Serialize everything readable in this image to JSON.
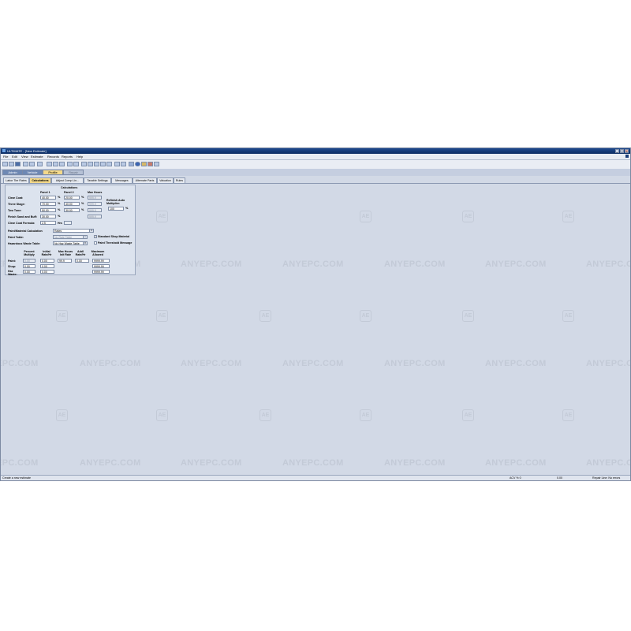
{
  "window": {
    "title": "ULTIMATE - [New Estimate]",
    "min": "_",
    "max": "□",
    "close": "×"
  },
  "menu": [
    "File",
    "Edit",
    "View",
    "Estimate",
    "Records",
    "Reports",
    "Help"
  ],
  "module_tabs": [
    "Admin",
    "Vehicle",
    "Profile",
    "Repair"
  ],
  "sub_tabs": [
    "Labor Tier Rates",
    "Calculations",
    "Adjust Comp Lin...",
    "Taxable Settings",
    "Messages",
    "Alternate Parts",
    "Valuation",
    "Rules"
  ],
  "calc": {
    "title": "Calculations",
    "col_paint1": "Panel 1",
    "col_paint2": "Panel 2",
    "col_max": "Max Hours",
    "rows": [
      {
        "label": "Clear Coat:",
        "p1": "40.00",
        "p2": "20.00",
        "max": "999.9"
      },
      {
        "label": "Three Stage:",
        "p1": "70.00",
        "p2": "40.00",
        "max": "999.9"
      },
      {
        "label": "Two Tone:",
        "p1": "50.00",
        "p2": "30.00",
        "max": "999.9"
      },
      {
        "label": "Finish Sand and Buff:",
        "p1": "30.00",
        "p2": "",
        "max": "999.9"
      }
    ],
    "pct": "%",
    "formula_label": "Clear Coat Formula:",
    "formula_value": "2.5",
    "formula_unit": "Hrs",
    "refinish_label": "Refinish Auto Multiplier:",
    "refinish_value": "100",
    "paint_material_label": "Paint/Material Calculation",
    "paint_material_value": "Rates",
    "paint_table_label": "Paint Table:",
    "paint_table_value": "No Rate Table",
    "hazwaste_label": "Hazardous Waste Table:",
    "hazwaste_value": "No Haz Waste Table",
    "std_shop_label": "Standard Shop Material",
    "paint_threshold_label": "Paint Threshold Message",
    "hdr_percent": "Percent Multiply",
    "hdr_initial": "Initial Rate/Hr",
    "hdr_maxhours": "Max Hours Init Rate",
    "hdr_addl": "Addl Rate/Hr",
    "hdr_maximum": "Maximum Allowed",
    "mat_rows": [
      {
        "label": "Paint:",
        "percent": "0.00",
        "initial": "0.00",
        "maxh": "99.9",
        "addl": "0.00",
        "maximum": "9999.99"
      },
      {
        "label": "Shop:",
        "percent": "0.00",
        "initial": "0.00",
        "maxh": "",
        "addl": "",
        "maximum": "9999.99"
      },
      {
        "label": "Haz Waste:",
        "percent": "0.00",
        "initial": "0.00",
        "maxh": "",
        "addl": "",
        "maximum": "9999.99"
      }
    ]
  },
  "watermark": {
    "text": "ANYEPC.COM",
    "logo": "AE"
  },
  "status": {
    "left": "Create a new estimate",
    "acv": "ACV % 0",
    "value": "0.00",
    "right": "Repair Line: No errors"
  },
  "icons": [
    "new-icon",
    "open-icon",
    "save-icon",
    "print-icon",
    "email-icon",
    "cut-icon",
    "copy-icon",
    "paste-icon",
    "calculator-icon",
    "help-icon",
    "close-icon"
  ],
  "colors": {
    "title_bar": "#0b2c63",
    "active_tab": "#f4d98a",
    "module_tab": "#6e88b4",
    "background": "#d2d9e6"
  }
}
